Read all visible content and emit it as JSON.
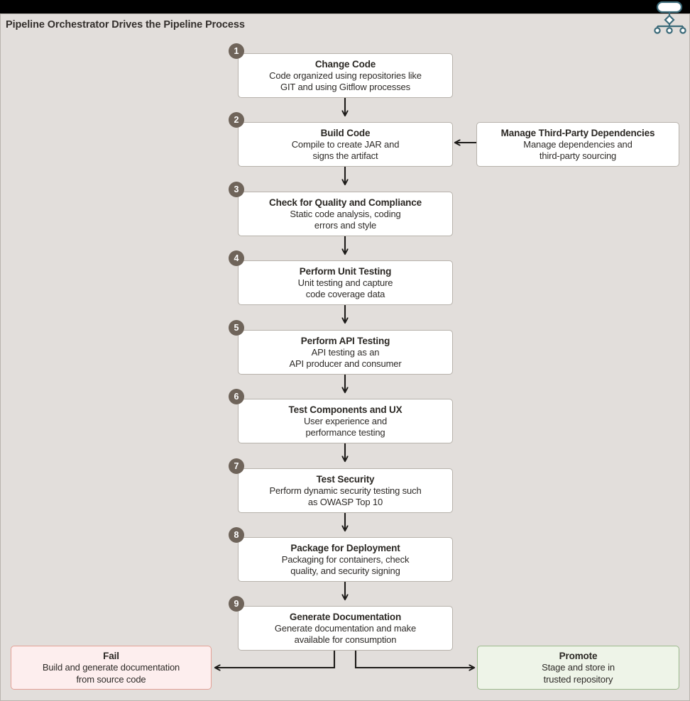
{
  "header": {
    "title": "Pipeline Orchestrator Drives the Pipeline Process",
    "icon": "pipeline-orchestrator-icon"
  },
  "diagram": {
    "type": "flowchart",
    "steps": [
      {
        "num": "1",
        "title": "Change Code",
        "desc": "Code organized using repositories like\nGIT and using Gitflow processes"
      },
      {
        "num": "2",
        "title": "Build Code",
        "desc": "Compile to create JAR and\nsigns the artifact"
      },
      {
        "num": "3",
        "title": "Check for Quality and Compliance",
        "desc": "Static code analysis, coding\nerrors and style"
      },
      {
        "num": "4",
        "title": "Perform Unit Testing",
        "desc": "Unit testing and capture\ncode coverage data"
      },
      {
        "num": "5",
        "title": "Perform API Testing",
        "desc": "API testing as an\nAPI producer and consumer"
      },
      {
        "num": "6",
        "title": "Test Components and UX",
        "desc": "User experience and\nperformance testing"
      },
      {
        "num": "7",
        "title": "Test Security",
        "desc": "Perform dynamic security testing such\nas OWASP Top 10"
      },
      {
        "num": "8",
        "title": "Package for Deployment",
        "desc": "Packaging for containers, check\nquality, and security signing"
      },
      {
        "num": "9",
        "title": "Generate Documentation",
        "desc": "Generate documentation and make\navailable for consumption"
      }
    ],
    "side": {
      "title": "Manage Third-Party Dependencies",
      "desc": "Manage dependencies and\nthird-party sourcing"
    },
    "outcomes": [
      {
        "key": "fail",
        "title": "Fail",
        "desc": "Build and generate documentation\nfrom source code"
      },
      {
        "key": "promote",
        "title": "Promote",
        "desc": "Stage and store in\ntrusted repository"
      }
    ]
  },
  "colors": {
    "background": "#e2dedb",
    "node_fill": "#ffffff",
    "node_border": "#b7b2ab",
    "badge": "#6f645a",
    "fail_fill": "#fdeeee",
    "fail_border": "#e3a095",
    "promote_fill": "#eef4e8",
    "promote_border": "#9bb98c",
    "arrow": "#1d1b19",
    "title_text": "#332f2c",
    "topbar": "#000000",
    "icon_stroke": "#3c6b7a"
  }
}
